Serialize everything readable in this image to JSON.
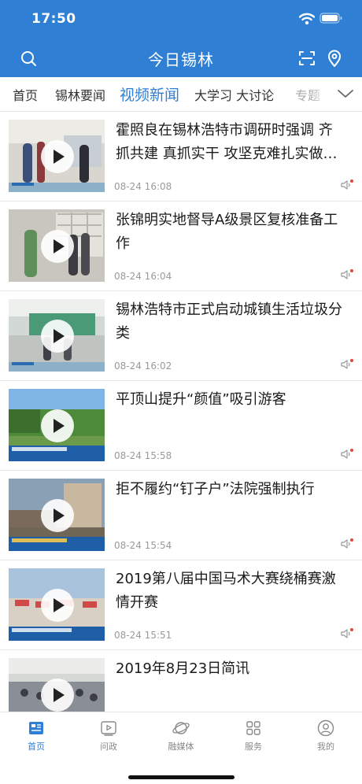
{
  "status_bar": {
    "time": "17:50"
  },
  "header": {
    "title": "今日锡林"
  },
  "tabs": [
    {
      "label": "首页",
      "state": "normal"
    },
    {
      "label": "锡林要闻",
      "state": "normal"
    },
    {
      "label": "视频新闻",
      "state": "active"
    },
    {
      "label": "大学习 大讨论",
      "state": "normal"
    },
    {
      "label": "专题",
      "state": "faded"
    }
  ],
  "news": [
    {
      "title": "霍照良在锡林浩特市调研时强调 齐抓共建 真抓实干 攻坚克难扎实做…",
      "time": "08-24 16:08"
    },
    {
      "title": "张锦明实地督导A级景区复核准备工作",
      "time": "08-24 16:04"
    },
    {
      "title": "锡林浩特市正式启动城镇生活垃圾分类",
      "time": "08-24 16:02"
    },
    {
      "title": "平顶山提升“颜值”吸引游客",
      "time": "08-24 15:58"
    },
    {
      "title": "拒不履约“钉子户”法院强制执行",
      "time": "08-24 15:54"
    },
    {
      "title": "2019第八届中国马术大赛绕桶赛激情开赛",
      "time": "08-24 15:51"
    },
    {
      "title": "2019年8月23日简讯",
      "time": ""
    }
  ],
  "bottom_nav": [
    {
      "label": "首页",
      "icon": "news-list-icon",
      "active": true
    },
    {
      "label": "问政",
      "icon": "video-play-icon",
      "active": false
    },
    {
      "label": "融媒体",
      "icon": "planet-icon",
      "active": false
    },
    {
      "label": "服务",
      "icon": "grid-icon",
      "active": false
    },
    {
      "label": "我的",
      "icon": "user-icon",
      "active": false
    }
  ],
  "colors": {
    "brand": "#2f7fd4",
    "badge": "#e64340"
  }
}
